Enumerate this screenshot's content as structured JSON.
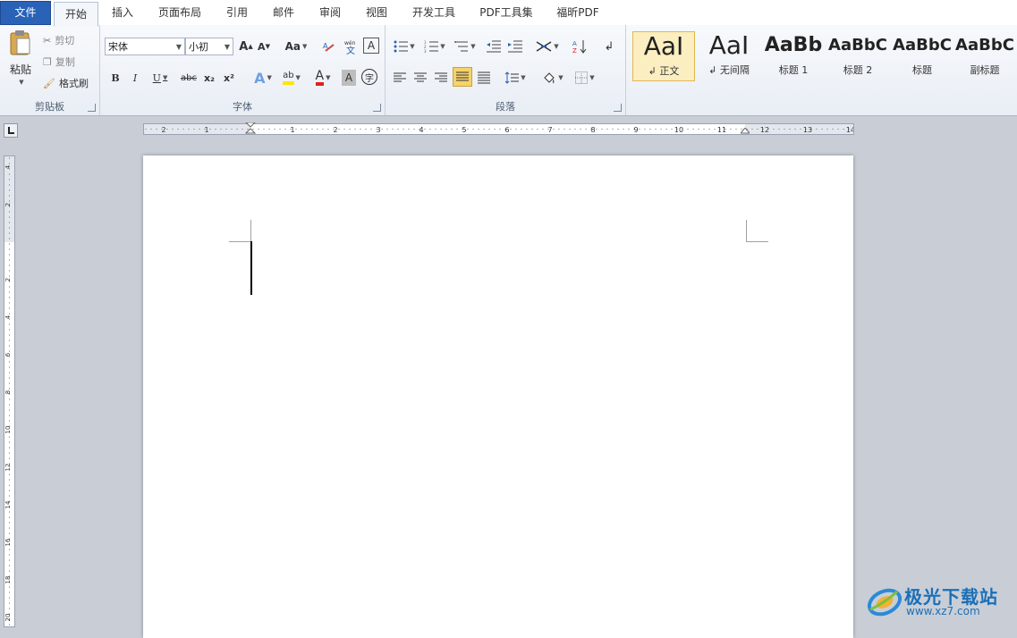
{
  "tabs": [
    {
      "label": "文件"
    },
    {
      "label": "开始"
    },
    {
      "label": "插入"
    },
    {
      "label": "页面布局"
    },
    {
      "label": "引用"
    },
    {
      "label": "邮件"
    },
    {
      "label": "审阅"
    },
    {
      "label": "视图"
    },
    {
      "label": "开发工具"
    },
    {
      "label": "PDF工具集"
    },
    {
      "label": "福昕PDF"
    }
  ],
  "clipboard": {
    "group_label": "剪贴板",
    "paste": "粘贴",
    "cut": "剪切",
    "copy": "复制",
    "format_painter": "格式刷"
  },
  "font": {
    "group_label": "字体",
    "family": "宋体",
    "size": "小初",
    "case_label": "Aa",
    "bold": "B",
    "italic": "I",
    "underline": "U",
    "strike": "abc",
    "subscript": "x₂",
    "superscript": "x²",
    "grow": "A",
    "shrink": "A",
    "highlight": "ab",
    "font_color": "A",
    "char_shade": "A",
    "enclose": "字"
  },
  "paragraph": {
    "group_label": "段落"
  },
  "styles": [
    {
      "sample": "AaI",
      "name": "↲ 正文"
    },
    {
      "sample": "AaI",
      "name": "↲ 无间隔"
    },
    {
      "sample": "AaBb",
      "name": "标题 1"
    },
    {
      "sample": "AaBbC",
      "name": "标题 2"
    },
    {
      "sample": "AaBbC",
      "name": "标题"
    },
    {
      "sample": "AaBbC",
      "name": "副标题"
    }
  ],
  "ruler": {
    "h_labels": [
      "2",
      "1",
      "1",
      "2",
      "3",
      "4",
      "5",
      "6",
      "7",
      "8",
      "9",
      "10",
      "11",
      "12",
      "13",
      "14"
    ],
    "v_labels": [
      "4",
      "2",
      "2",
      "4",
      "6",
      "8",
      "10",
      "12",
      "14",
      "16",
      "18",
      "20"
    ]
  },
  "watermark": {
    "title": "极光下载站",
    "url": "www.xz7.com"
  },
  "colors": {
    "accent": "#2a62b8",
    "highlight": "#f6e3a0",
    "style_selected": "#f3d77c"
  }
}
